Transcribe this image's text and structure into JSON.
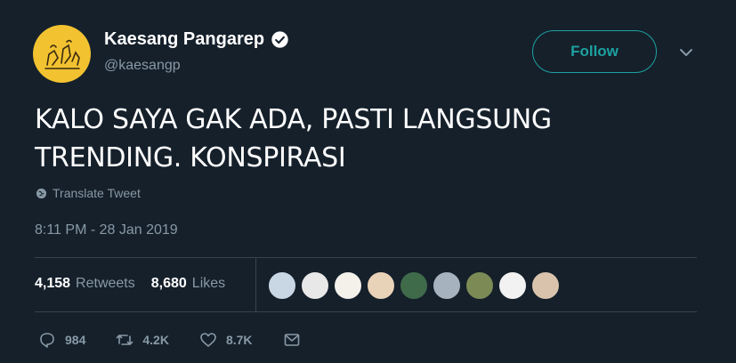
{
  "author": {
    "display_name": "Kaesang Pangarep",
    "handle": "@kaesangp",
    "verified": true,
    "avatar_color": "#f2c230"
  },
  "follow_label": "Follow",
  "tweet": {
    "text_line1": "KALO SAYA GAK ADA, PASTI LANGSUNG",
    "text_line2": "TRENDING. KONSPIRASI",
    "translate_label": "Translate Tweet",
    "timestamp": "8:11 PM - 28 Jan 2019"
  },
  "stats": {
    "retweets_count": "4,158",
    "retweets_label": "Retweets",
    "likes_count": "8,680",
    "likes_label": "Likes"
  },
  "likers": [
    {
      "color": "#c9d6e3"
    },
    {
      "color": "#e8e8e8"
    },
    {
      "color": "#f4f0ea"
    },
    {
      "color": "#e9d3b8"
    },
    {
      "color": "#3f6b4a"
    },
    {
      "color": "#a6b3bf"
    },
    {
      "color": "#7c8a55"
    },
    {
      "color": "#f2f2f2"
    },
    {
      "color": "#d9c3ad"
    }
  ],
  "actions": {
    "reply_count": "984",
    "retweet_count": "4.2K",
    "like_count": "8.7K"
  },
  "colors": {
    "background": "#15202b",
    "accent": "#1da1a0",
    "muted": "#8899a6",
    "divider": "#38444d"
  },
  "icons": [
    "verified-badge-icon",
    "chevron-down-icon",
    "globe-icon",
    "reply-icon",
    "retweet-icon",
    "like-heart-icon",
    "direct-message-icon"
  ]
}
